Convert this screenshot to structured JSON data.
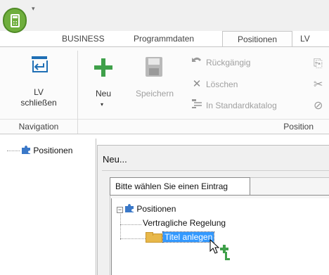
{
  "title_bar": {
    "qat_icon": "quick-access-dropdown-icon"
  },
  "tabs": [
    {
      "label": "BUSINESS",
      "active": false
    },
    {
      "label": "Programmdaten",
      "active": false
    },
    {
      "label": "Positionen",
      "active": true
    },
    {
      "label": "LV",
      "active": false
    }
  ],
  "ribbon": {
    "navigation": {
      "group_label": "Navigation",
      "lv_close": {
        "line1": "LV",
        "line2": "schließen",
        "icon": "lv-close-icon"
      }
    },
    "position": {
      "group_label": "Position",
      "neu": {
        "label": "Neu",
        "icon": "plus-icon",
        "caret": "▾"
      },
      "speichern": {
        "label": "Speichern",
        "icon": "save-icon",
        "enabled": false
      },
      "rueckgaengig": {
        "label": "Rückgängig",
        "icon": "undo-icon",
        "enabled": false
      },
      "loeschen": {
        "label": "Löschen",
        "icon": "delete-icon",
        "enabled": false
      },
      "standardkatalog": {
        "label": "In Standardkatalog",
        "icon": "catalog-icon",
        "enabled": false
      }
    }
  },
  "left_tree": {
    "root": {
      "label": "Positionen",
      "icon": "puzzle-icon"
    }
  },
  "dialog": {
    "title": "Neu...",
    "tab_label": "Bitte wählen Sie einen Eintrag",
    "tree": {
      "root": {
        "label": "Positionen",
        "expander": "−",
        "icon": "puzzle-icon"
      },
      "children": [
        {
          "label": "Vertragliche Regelung"
        },
        {
          "label": "Titel anlegen",
          "icon": "folder-icon",
          "selected": true
        }
      ]
    }
  },
  "colors": {
    "accent": "#6fae3d",
    "add_green": "#3fa04a",
    "selection": "#3399ff",
    "folder": "#e8b84a"
  }
}
